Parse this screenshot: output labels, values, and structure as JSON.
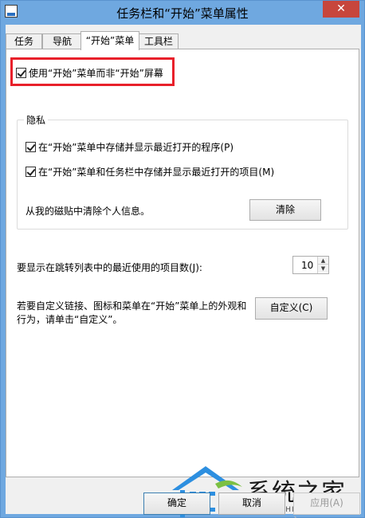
{
  "window": {
    "title": "任务栏和“开始”菜单属性",
    "close_glyph": "✕",
    "app_icon": "taskbar-properties-icon"
  },
  "tabs": [
    {
      "label": "任务栏"
    },
    {
      "label": "导航"
    },
    {
      "label": "“开始”菜单"
    },
    {
      "label": "工具栏"
    }
  ],
  "active_tab": "“开始”菜单",
  "start_screen": {
    "label": "使用“开始”菜单而非“开始”屏幕",
    "checked": true,
    "highlight_color": "#e8202a"
  },
  "privacy": {
    "legend": "隐私",
    "items": [
      {
        "label": "在“开始”菜单中存储并显示最近打开的程序(P)",
        "checked": true
      },
      {
        "label": "在“开始”菜单和任务栏中存储并显示最近打开的项目(M)",
        "checked": true
      }
    ],
    "clear_text": "从我的磁贴中清除个人信息。",
    "clear_button": "清除"
  },
  "jumplist": {
    "label": "要显示在跳转列表中的最近使用的项目数(J):",
    "value": "10",
    "up_glyph": "▲",
    "down_glyph": "▼"
  },
  "customize": {
    "text_line1": "若要自定义链接、图标和菜单在“开始”菜单上的外观和",
    "text_line2": "行为，请单击“自定义”。",
    "button": "自定义(C)"
  },
  "watermark": {
    "text": "系统之家",
    "sub": "XITONGZHIJIA.NET"
  },
  "footer": {
    "ok": "确定",
    "cancel": "取消",
    "apply": "应用(A)"
  }
}
